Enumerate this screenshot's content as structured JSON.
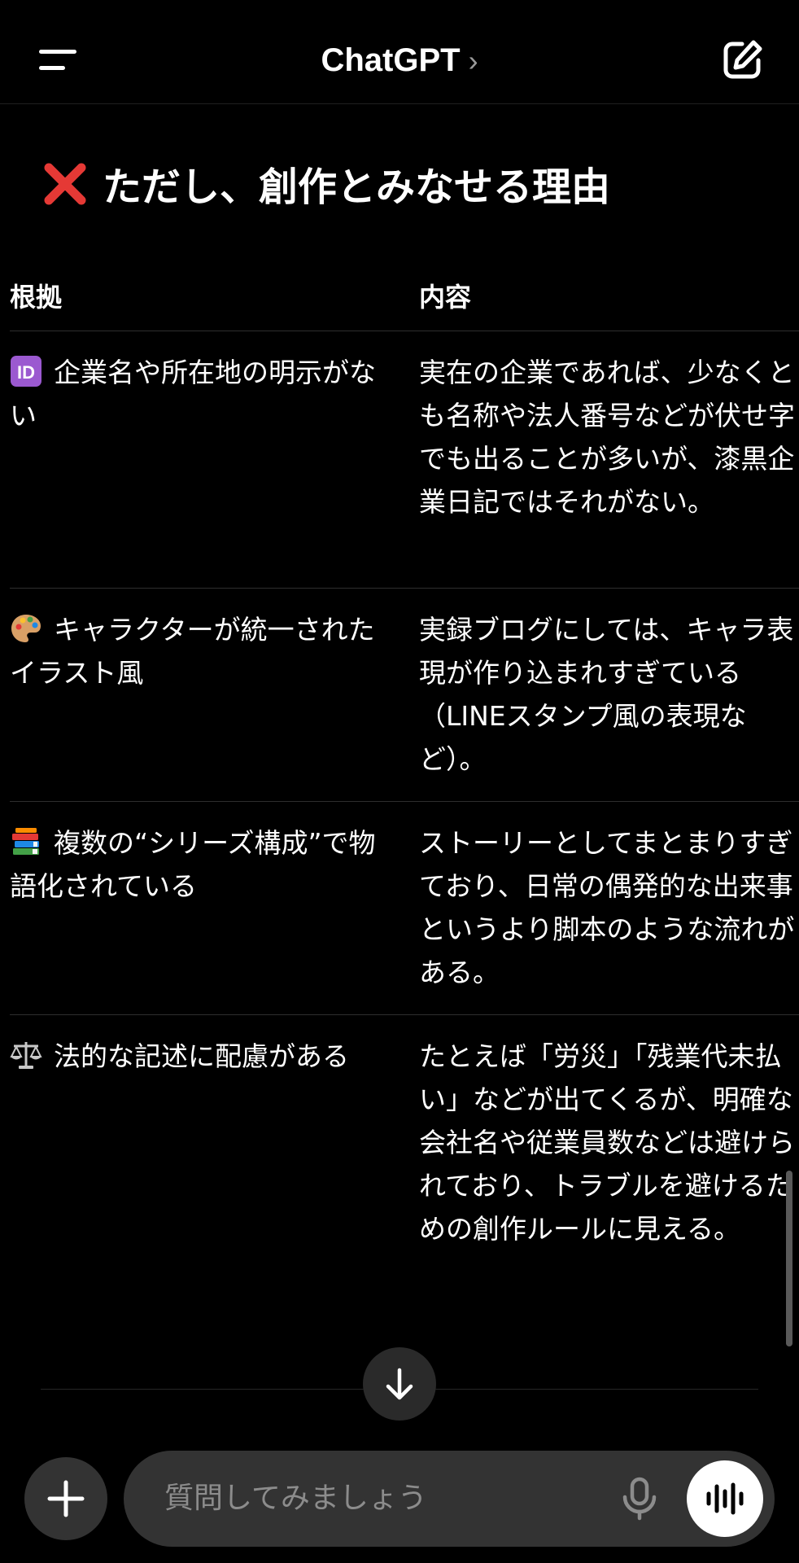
{
  "header": {
    "title": "ChatGPT",
    "chevron": "›",
    "menu_icon": "menu-icon",
    "compose_icon": "compose-icon"
  },
  "section": {
    "heading": "ただし、創作とみなせる理由",
    "heading_icon": "cross-mark-icon"
  },
  "table": {
    "headers": [
      "根拠",
      "内容"
    ],
    "rows": [
      {
        "icon": "id-icon",
        "reason": "企業名や所在地の明示がない",
        "detail": "実在の企業であれば、少なくとも名称や法人番号などが伏せ字でも出ることが多いが、漆黒企業日記ではそれがない。"
      },
      {
        "icon": "palette-icon",
        "reason": "キャラクターが統一されたイラスト風",
        "detail": "実録ブログにしては、キャラ表現が作り込まれすぎている（LINEスタンプ風の表現など）。"
      },
      {
        "icon": "books-icon",
        "reason": "複数の“シリーズ構成”で物語化されている",
        "detail": "ストーリーとしてまとまりすぎており、日常の偶発的な出来事というより脚本のような流れがある。"
      },
      {
        "icon": "scales-icon",
        "reason": "法的な記述に配慮がある",
        "detail": "たとえば「労災」「残業代未払い」などが出てくるが、明確な会社名や従業員数などは避けられており、トラブルを避けるための創作ルールに見える。"
      }
    ]
  },
  "composer": {
    "placeholder": "質問してみましょう",
    "plus_icon": "plus-icon",
    "mic_icon": "mic-icon",
    "voice_icon": "voice-waveform-icon",
    "scroll_icon": "arrow-down-icon"
  },
  "colors": {
    "background": "#000000",
    "text": "#ffffff",
    "divider": "#2e2e2e",
    "pill": "#333333",
    "placeholder": "#8c8c8c",
    "cross": "#e53935"
  }
}
